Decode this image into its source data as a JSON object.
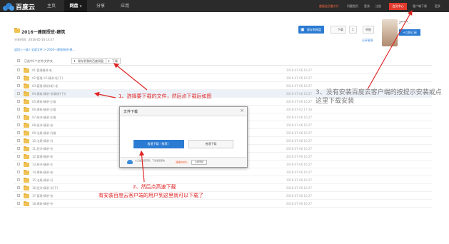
{
  "nav": {
    "logo_text": "百度云",
    "items": [
      {
        "label": "主页",
        "active": false
      },
      {
        "label": "网盘",
        "active": true
      },
      {
        "label": "分享",
        "active": false
      },
      {
        "label": "应用",
        "active": false
      }
    ],
    "right_links": {
      "hot": "超级会员看大片",
      "l1": "问题首页",
      "l2": "登录",
      "l3": "注册",
      "vip": "会员中心",
      "client": "客户端下载",
      "more": "更多"
    }
  },
  "file": {
    "title": "2016一建面授班-建筑",
    "share_time": "分享时间：2016-05-16 14:47",
    "save_button": "保存到网盘",
    "download_button": "下载",
    "third_button": "1",
    "more_button": "举报"
  },
  "ad": {
    "name": "2*****...",
    "subscribe": "+立即订阅",
    "more_share": "分享更多"
  },
  "breadcrumb": "返回上一级 | 全部文件 > 2016一建面授班-建...",
  "list": {
    "select_text": "已选中1个文件/文件夹",
    "btn_save": "保存到我的百度网盘",
    "btn_download": "下载",
    "rows": [
      {
        "name": "01.管理精讲-毛",
        "date": "2016-07-06 16:27",
        "hl": false
      },
      {
        "name": "02.管理-1Z-精讲-毛(下)",
        "date": "2016-07-06 16:27",
        "hl": false
      },
      {
        "name": "03.管理-精讲(新)-毛",
        "date": "2016-07-06 16:27",
        "hl": false
      },
      {
        "name": "04.建筑-精讲-肖(精讲(下))",
        "date": "2016-07-06 16:27",
        "hl": true
      },
      {
        "name": "05.建筑-精讲-左雄",
        "date": "2016-07-06 16:27",
        "hl": false
      },
      {
        "name": "06.建筑-精讲-左雄",
        "date": "2016-07-02 17:26",
        "hl": false
      },
      {
        "name": "07.经济-精讲-左雄",
        "date": "2016-07-06 16:27",
        "hl": false
      },
      {
        "name": "08.经济-精讲-张",
        "date": "2016-07-06 16:27",
        "hl": false
      },
      {
        "name": "09.法规-精讲-冯雄",
        "date": "2016-07-06 16:27",
        "hl": false
      },
      {
        "name": "10.法规-精讲-冯",
        "date": "2016-07-06 16:27",
        "hl": false
      },
      {
        "name": "11.经济-精讲-孙",
        "date": "2016-07-06 16:27",
        "hl": false
      },
      {
        "name": "12.管理-精讲-毛",
        "date": "2016-07-06 16:27",
        "hl": false
      },
      {
        "name": "13.经济-精讲-左",
        "date": "2016-07-06 16:27",
        "hl": false
      },
      {
        "name": "14.建筑-精讲-张",
        "date": "2016-07-06 16:27",
        "hl": false
      },
      {
        "name": "15.法规-精讲-冯",
        "date": "2016-07-06 16:27",
        "hl": false
      },
      {
        "name": "16.经济-精讲-孙(下)",
        "date": "2016-07-06 16:27",
        "hl": false
      },
      {
        "name": "17.管理-精讲-张",
        "date": "2016-07-06 16:27",
        "hl": false
      },
      {
        "name": "18.建筑-精讲-孙",
        "date": "2016-07-06 16:27",
        "hl": false
      }
    ]
  },
  "dialog": {
    "title": "文件下载",
    "fast_button": "极速下载（推荐）",
    "normal_button": "普通下载",
    "footer_text": "从云盘直接获取，下载速度更快",
    "footer_badge": "提速200%",
    "footer_button": "立即安装"
  },
  "annotations": {
    "step1": "1、选择要下载的文件，然后点下载后如图",
    "step2": "2、然后点高速下载",
    "step2_sub": "有安装百度云客户端的用户到这里就可以下载了",
    "step3": "3、没有安装百度云客户端的按提示安装或点这里下载安装"
  },
  "colors": {
    "accent": "#2b7bd3",
    "annotation": "#e02525",
    "topbar": "#2b2b2b"
  }
}
